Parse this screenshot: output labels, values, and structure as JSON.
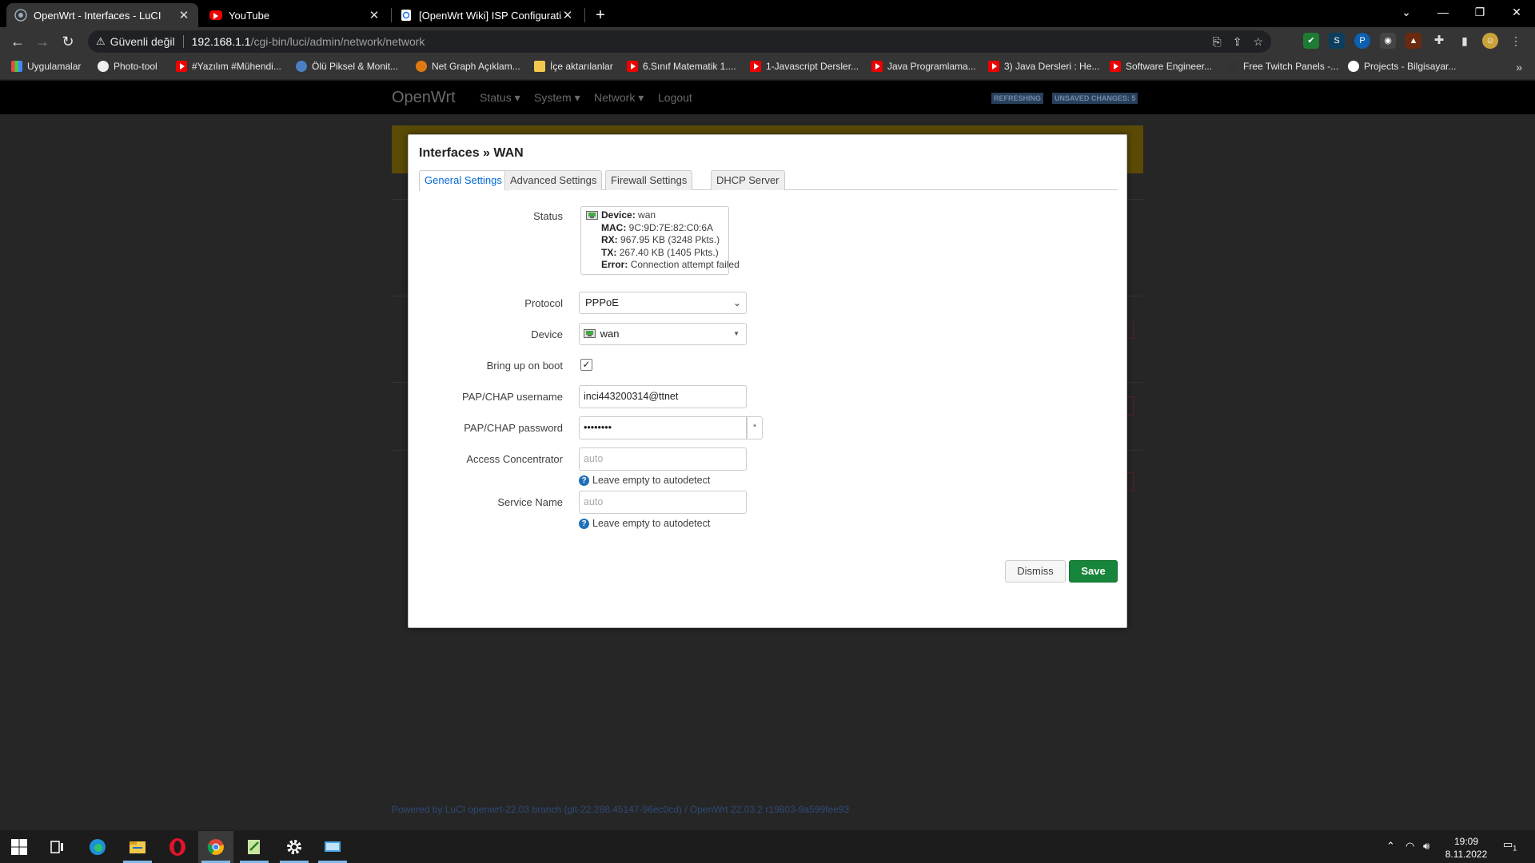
{
  "browser": {
    "tabs": [
      {
        "title": "OpenWrt - Interfaces - LuCI",
        "active": true
      },
      {
        "title": "YouTube",
        "active": false
      },
      {
        "title": "[OpenWrt Wiki] ISP Configuration",
        "active": false
      }
    ],
    "security_label": "Güvenli değil",
    "url_host": "192.168.1.1",
    "url_path": "/cgi-bin/luci/admin/network/network",
    "bookmarks": [
      "Uygulamalar",
      "Photo-tool",
      "#Yazılım #Mühendi...",
      "Ölü Piksel & Monit...",
      "Net Graph Açıklam...",
      "İçe aktarılanlar",
      "6.Sınıf Matematik 1....",
      "1-Javascript Dersler...",
      "Java Programlama...",
      "3) Java Dersleri : He...",
      "Software Engineer...",
      "Free Twitch Panels -...",
      "Projects - Bilgisayar..."
    ],
    "colors": {
      "tabstrip": "#000000",
      "toolbar": "#353535",
      "omnibox": "#202124"
    }
  },
  "luci": {
    "brand": "OpenWrt",
    "menu": [
      "Status",
      "System",
      "Network",
      "Logout"
    ],
    "badges": {
      "refreshing": "REFRESHING",
      "unsaved": "UNSAVED CHANGES: 5"
    },
    "footer": "Powered by LuCI openwrt-22.03 branch (git-22.288.45147-96ec0cd) / OpenWrt 22.03.2 r19803-9a599fee93"
  },
  "modal": {
    "title": "Interfaces » WAN",
    "tabs": [
      "General Settings",
      "Advanced Settings",
      "Firewall Settings",
      "DHCP Server"
    ],
    "status": {
      "label": "Status",
      "device_key": "Device:",
      "device_val": "wan",
      "mac_key": "MAC:",
      "mac_val": "9C:9D:7E:82:C0:6A",
      "rx_key": "RX:",
      "rx_val": "967.95 KB (3248 Pkts.)",
      "tx_key": "TX:",
      "tx_val": "267.40 KB (1405 Pkts.)",
      "error_key": "Error:",
      "error_val": "Connection attempt failed"
    },
    "protocol": {
      "label": "Protocol",
      "value": "PPPoE"
    },
    "device": {
      "label": "Device",
      "value": "wan"
    },
    "boot": {
      "label": "Bring up on boot",
      "checked": true
    },
    "username": {
      "label": "PAP/CHAP username",
      "value": "inci443200314@ttnet"
    },
    "password": {
      "label": "PAP/CHAP password",
      "value": "••••••••",
      "reveal": "*"
    },
    "ac": {
      "label": "Access Concentrator",
      "placeholder": "auto",
      "hint": "Leave empty to autodetect"
    },
    "service": {
      "label": "Service Name",
      "placeholder": "auto",
      "hint": "Leave empty to autodetect"
    },
    "buttons": {
      "dismiss": "Dismiss",
      "save": "Save"
    },
    "colors": {
      "save": "#17853b",
      "active_tab": "#0069d6"
    }
  },
  "taskbar": {
    "time": "19:09",
    "date": "8.11.2022",
    "notifications": "1"
  }
}
